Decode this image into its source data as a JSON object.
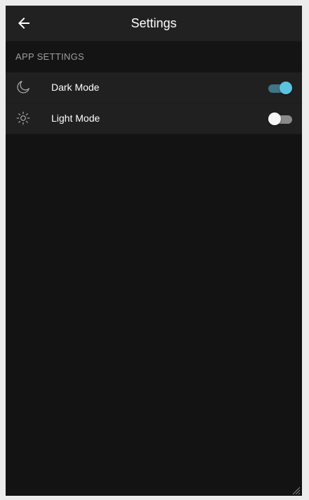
{
  "app_bar": {
    "title": "Settings",
    "back_icon": "arrow-left-icon"
  },
  "section": {
    "label": "APP SETTINGS"
  },
  "settings": [
    {
      "icon": "moon-icon",
      "label": "Dark Mode",
      "enabled": true
    },
    {
      "icon": "sun-icon",
      "label": "Light Mode",
      "enabled": false
    }
  ],
  "colors": {
    "accent": "#5bc2e0",
    "accent_track": "#3f7585",
    "background": "#131313",
    "app_bar": "#212121",
    "row": "#202020"
  }
}
